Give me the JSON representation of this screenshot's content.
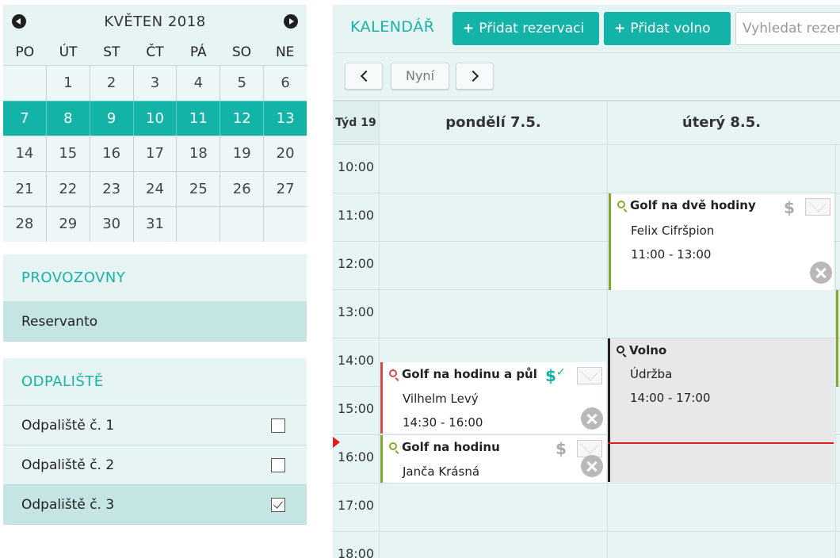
{
  "minical": {
    "title": "KVĚTEN 2018",
    "weekdays": [
      "PO",
      "ÚT",
      "ST",
      "ČT",
      "PÁ",
      "SO",
      "NE"
    ],
    "rows": [
      [
        "",
        "1",
        "2",
        "3",
        "4",
        "5",
        "6"
      ],
      [
        "7",
        "8",
        "9",
        "10",
        "11",
        "12",
        "13"
      ],
      [
        "14",
        "15",
        "16",
        "17",
        "18",
        "19",
        "20"
      ],
      [
        "21",
        "22",
        "23",
        "24",
        "25",
        "26",
        "27"
      ],
      [
        "28",
        "29",
        "30",
        "31",
        "",
        "",
        ""
      ]
    ],
    "selected_week_row": 1,
    "accent_color": "#13b3a8"
  },
  "locations": {
    "heading": "PROVOZOVNY",
    "items": [
      {
        "label": "Reservanto",
        "active": true
      }
    ]
  },
  "tees": {
    "heading": "ODPALIŠTĚ",
    "items": [
      {
        "label": "Odpaliště č. 1",
        "checked": false
      },
      {
        "label": "Odpaliště č. 2",
        "checked": false
      },
      {
        "label": "Odpaliště č. 3",
        "checked": true
      }
    ]
  },
  "toolbar": {
    "brand": "KALENDÁŘ",
    "add_reservation": "Přidat rezervaci",
    "add_free": "Přidat volno",
    "search_placeholder": "Vyhledat rezervaci"
  },
  "nav": {
    "now_label": "Nyní"
  },
  "week": {
    "label": "Týd 19",
    "days": [
      "pondělí 7.5.",
      "úterý 8.5."
    ],
    "hours": [
      "10:00",
      "11:00",
      "12:00",
      "13:00",
      "14:00",
      "15:00",
      "16:00",
      "17:00",
      "18:00"
    ]
  },
  "events": {
    "golf_two_hours": {
      "title": "Golf na dvě hodiny",
      "customer": "Felix Cifršpion",
      "time": "11:00 - 13:00",
      "paid": false
    },
    "free": {
      "title": "Volno",
      "reason": "Údržba",
      "time": "14:00 - 17:00"
    },
    "golf_hour_half": {
      "title": "Golf na hodinu a půl",
      "customer": "Vilhelm Levý",
      "time": "14:30 - 16:00",
      "paid": true
    },
    "golf_hour": {
      "title": "Golf na hodinu",
      "customer": "Janča Krásná",
      "paid": false
    }
  },
  "icons": {
    "dollar": "$",
    "paid_check": "✓"
  },
  "colors": {
    "accent": "#13b3a8",
    "now_line": "#e02020",
    "event_green": "#84a92a",
    "event_red": "#d24a4a"
  }
}
